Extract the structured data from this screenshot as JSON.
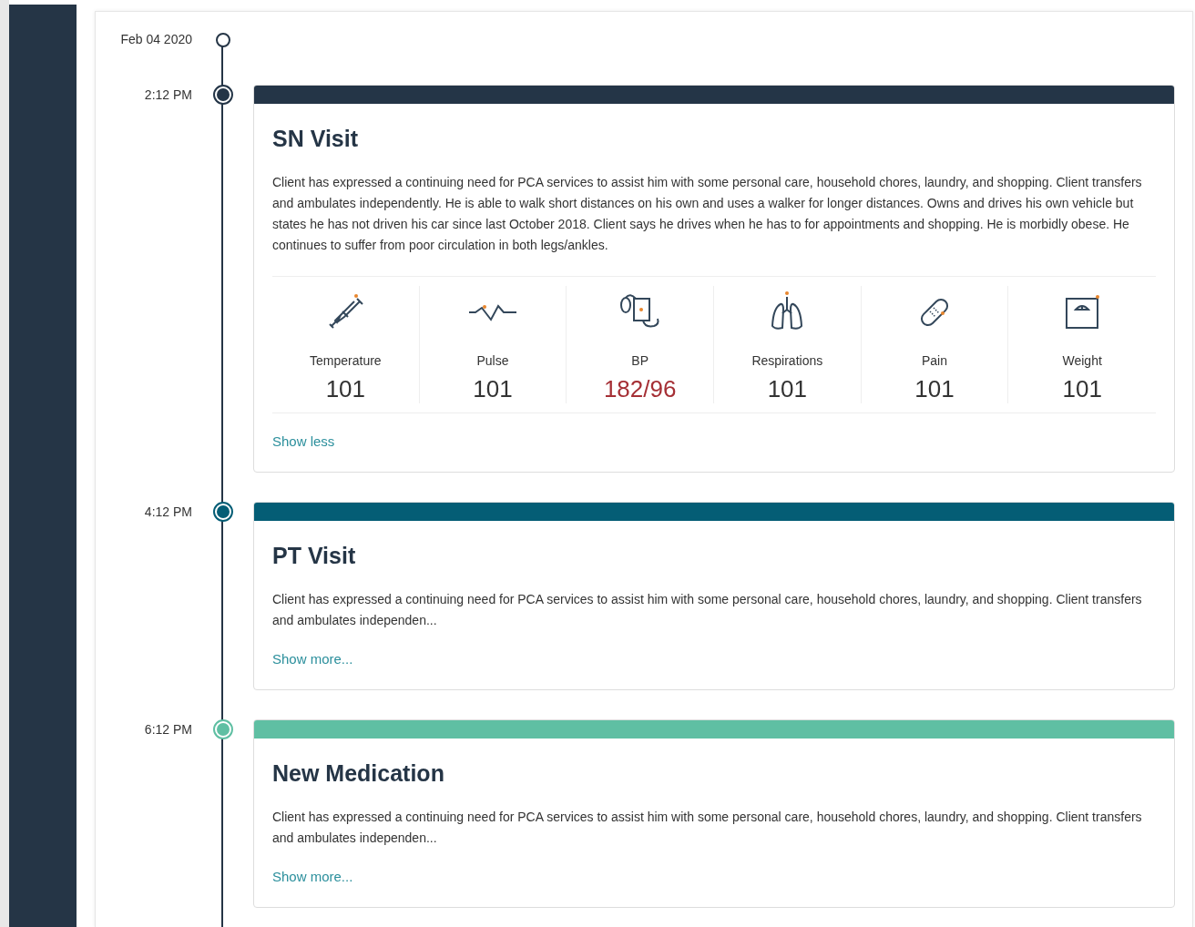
{
  "timeline": {
    "date": "Feb 04 2020",
    "entries": [
      {
        "time": "2:12 PM",
        "color": "#243547",
        "title": "SN Visit",
        "text": "Client has expressed a continuing need for PCA services to assist him with some personal care, household chores, laundry, and shopping. Client transfers and ambulates independently. He is able to walk short distances on his own and uses a walker for longer distances. Owns and drives his own vehicle but states he has not driven his car since last October 2018. Client says he drives when he has to for appointments and shopping. He is morbidly obese. He continues to suffer from poor circulation in both legs/ankles.",
        "vitals": [
          {
            "kind": "temperature",
            "label": "Temperature",
            "value": "101",
            "alert": false
          },
          {
            "kind": "pulse",
            "label": "Pulse",
            "value": "101",
            "alert": false
          },
          {
            "kind": "bp",
            "label": "BP",
            "value": "182/96",
            "alert": true
          },
          {
            "kind": "respirations",
            "label": "Respirations",
            "value": "101",
            "alert": false
          },
          {
            "kind": "pain",
            "label": "Pain",
            "value": "101",
            "alert": false
          },
          {
            "kind": "weight",
            "label": "Weight",
            "value": "101",
            "alert": false
          }
        ],
        "link": "Show less"
      },
      {
        "time": "4:12 PM",
        "color": "#045d75",
        "title": "PT Visit",
        "text": "Client has expressed a continuing need for PCA services to assist him with some personal care, household chores, laundry, and shopping. Client transfers and ambulates independen...",
        "link": "Show more..."
      },
      {
        "time": "6:12 PM",
        "color": "#5fbfa3",
        "title": "New Medication",
        "text": "Client has expressed a continuing need for PCA services to assist him with some personal care, household chores, laundry, and shopping. Client transfers and ambulates independen...",
        "link": "Show more..."
      }
    ]
  }
}
